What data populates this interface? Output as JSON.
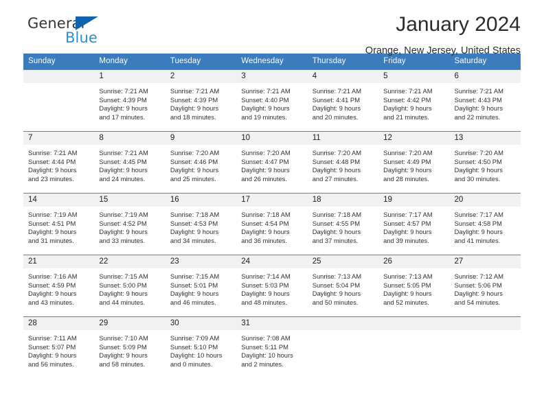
{
  "brand": {
    "name_part1": "General",
    "name_part2": "Blue",
    "triangle_icon": "triangle-flag-icon",
    "accent_color": "#2a8fd4",
    "triangle_color": "#1263ae"
  },
  "header": {
    "title": "January 2024",
    "subtitle": "Orange, New Jersey, United States"
  },
  "theme": {
    "header_row_bg": "#3a7cbe",
    "header_row_text": "#ffffff",
    "daynum_bg": "#f1f1f1",
    "row_border": "#4a86bf"
  },
  "calendar": {
    "weekday_headers": [
      "Sunday",
      "Monday",
      "Tuesday",
      "Wednesday",
      "Thursday",
      "Friday",
      "Saturday"
    ],
    "weeks": [
      [
        {
          "day": "",
          "empty": true,
          "sunrise": "",
          "sunset": "",
          "daylight_line1": "",
          "daylight_line2": ""
        },
        {
          "day": "1",
          "sunrise": "Sunrise: 7:21 AM",
          "sunset": "Sunset: 4:39 PM",
          "daylight_line1": "Daylight: 9 hours",
          "daylight_line2": "and 17 minutes."
        },
        {
          "day": "2",
          "sunrise": "Sunrise: 7:21 AM",
          "sunset": "Sunset: 4:39 PM",
          "daylight_line1": "Daylight: 9 hours",
          "daylight_line2": "and 18 minutes."
        },
        {
          "day": "3",
          "sunrise": "Sunrise: 7:21 AM",
          "sunset": "Sunset: 4:40 PM",
          "daylight_line1": "Daylight: 9 hours",
          "daylight_line2": "and 19 minutes."
        },
        {
          "day": "4",
          "sunrise": "Sunrise: 7:21 AM",
          "sunset": "Sunset: 4:41 PM",
          "daylight_line1": "Daylight: 9 hours",
          "daylight_line2": "and 20 minutes."
        },
        {
          "day": "5",
          "sunrise": "Sunrise: 7:21 AM",
          "sunset": "Sunset: 4:42 PM",
          "daylight_line1": "Daylight: 9 hours",
          "daylight_line2": "and 21 minutes."
        },
        {
          "day": "6",
          "sunrise": "Sunrise: 7:21 AM",
          "sunset": "Sunset: 4:43 PM",
          "daylight_line1": "Daylight: 9 hours",
          "daylight_line2": "and 22 minutes."
        }
      ],
      [
        {
          "day": "7",
          "sunrise": "Sunrise: 7:21 AM",
          "sunset": "Sunset: 4:44 PM",
          "daylight_line1": "Daylight: 9 hours",
          "daylight_line2": "and 23 minutes."
        },
        {
          "day": "8",
          "sunrise": "Sunrise: 7:21 AM",
          "sunset": "Sunset: 4:45 PM",
          "daylight_line1": "Daylight: 9 hours",
          "daylight_line2": "and 24 minutes."
        },
        {
          "day": "9",
          "sunrise": "Sunrise: 7:20 AM",
          "sunset": "Sunset: 4:46 PM",
          "daylight_line1": "Daylight: 9 hours",
          "daylight_line2": "and 25 minutes."
        },
        {
          "day": "10",
          "sunrise": "Sunrise: 7:20 AM",
          "sunset": "Sunset: 4:47 PM",
          "daylight_line1": "Daylight: 9 hours",
          "daylight_line2": "and 26 minutes."
        },
        {
          "day": "11",
          "sunrise": "Sunrise: 7:20 AM",
          "sunset": "Sunset: 4:48 PM",
          "daylight_line1": "Daylight: 9 hours",
          "daylight_line2": "and 27 minutes."
        },
        {
          "day": "12",
          "sunrise": "Sunrise: 7:20 AM",
          "sunset": "Sunset: 4:49 PM",
          "daylight_line1": "Daylight: 9 hours",
          "daylight_line2": "and 28 minutes."
        },
        {
          "day": "13",
          "sunrise": "Sunrise: 7:20 AM",
          "sunset": "Sunset: 4:50 PM",
          "daylight_line1": "Daylight: 9 hours",
          "daylight_line2": "and 30 minutes."
        }
      ],
      [
        {
          "day": "14",
          "sunrise": "Sunrise: 7:19 AM",
          "sunset": "Sunset: 4:51 PM",
          "daylight_line1": "Daylight: 9 hours",
          "daylight_line2": "and 31 minutes."
        },
        {
          "day": "15",
          "sunrise": "Sunrise: 7:19 AM",
          "sunset": "Sunset: 4:52 PM",
          "daylight_line1": "Daylight: 9 hours",
          "daylight_line2": "and 33 minutes."
        },
        {
          "day": "16",
          "sunrise": "Sunrise: 7:18 AM",
          "sunset": "Sunset: 4:53 PM",
          "daylight_line1": "Daylight: 9 hours",
          "daylight_line2": "and 34 minutes."
        },
        {
          "day": "17",
          "sunrise": "Sunrise: 7:18 AM",
          "sunset": "Sunset: 4:54 PM",
          "daylight_line1": "Daylight: 9 hours",
          "daylight_line2": "and 36 minutes."
        },
        {
          "day": "18",
          "sunrise": "Sunrise: 7:18 AM",
          "sunset": "Sunset: 4:55 PM",
          "daylight_line1": "Daylight: 9 hours",
          "daylight_line2": "and 37 minutes."
        },
        {
          "day": "19",
          "sunrise": "Sunrise: 7:17 AM",
          "sunset": "Sunset: 4:57 PM",
          "daylight_line1": "Daylight: 9 hours",
          "daylight_line2": "and 39 minutes."
        },
        {
          "day": "20",
          "sunrise": "Sunrise: 7:17 AM",
          "sunset": "Sunset: 4:58 PM",
          "daylight_line1": "Daylight: 9 hours",
          "daylight_line2": "and 41 minutes."
        }
      ],
      [
        {
          "day": "21",
          "sunrise": "Sunrise: 7:16 AM",
          "sunset": "Sunset: 4:59 PM",
          "daylight_line1": "Daylight: 9 hours",
          "daylight_line2": "and 43 minutes."
        },
        {
          "day": "22",
          "sunrise": "Sunrise: 7:15 AM",
          "sunset": "Sunset: 5:00 PM",
          "daylight_line1": "Daylight: 9 hours",
          "daylight_line2": "and 44 minutes."
        },
        {
          "day": "23",
          "sunrise": "Sunrise: 7:15 AM",
          "sunset": "Sunset: 5:01 PM",
          "daylight_line1": "Daylight: 9 hours",
          "daylight_line2": "and 46 minutes."
        },
        {
          "day": "24",
          "sunrise": "Sunrise: 7:14 AM",
          "sunset": "Sunset: 5:03 PM",
          "daylight_line1": "Daylight: 9 hours",
          "daylight_line2": "and 48 minutes."
        },
        {
          "day": "25",
          "sunrise": "Sunrise: 7:13 AM",
          "sunset": "Sunset: 5:04 PM",
          "daylight_line1": "Daylight: 9 hours",
          "daylight_line2": "and 50 minutes."
        },
        {
          "day": "26",
          "sunrise": "Sunrise: 7:13 AM",
          "sunset": "Sunset: 5:05 PM",
          "daylight_line1": "Daylight: 9 hours",
          "daylight_line2": "and 52 minutes."
        },
        {
          "day": "27",
          "sunrise": "Sunrise: 7:12 AM",
          "sunset": "Sunset: 5:06 PM",
          "daylight_line1": "Daylight: 9 hours",
          "daylight_line2": "and 54 minutes."
        }
      ],
      [
        {
          "day": "28",
          "sunrise": "Sunrise: 7:11 AM",
          "sunset": "Sunset: 5:07 PM",
          "daylight_line1": "Daylight: 9 hours",
          "daylight_line2": "and 56 minutes."
        },
        {
          "day": "29",
          "sunrise": "Sunrise: 7:10 AM",
          "sunset": "Sunset: 5:09 PM",
          "daylight_line1": "Daylight: 9 hours",
          "daylight_line2": "and 58 minutes."
        },
        {
          "day": "30",
          "sunrise": "Sunrise: 7:09 AM",
          "sunset": "Sunset: 5:10 PM",
          "daylight_line1": "Daylight: 10 hours",
          "daylight_line2": "and 0 minutes."
        },
        {
          "day": "31",
          "sunrise": "Sunrise: 7:08 AM",
          "sunset": "Sunset: 5:11 PM",
          "daylight_line1": "Daylight: 10 hours",
          "daylight_line2": "and 2 minutes."
        },
        {
          "day": "",
          "empty": true,
          "sunrise": "",
          "sunset": "",
          "daylight_line1": "",
          "daylight_line2": ""
        },
        {
          "day": "",
          "empty": true,
          "sunrise": "",
          "sunset": "",
          "daylight_line1": "",
          "daylight_line2": ""
        },
        {
          "day": "",
          "empty": true,
          "sunrise": "",
          "sunset": "",
          "daylight_line1": "",
          "daylight_line2": ""
        }
      ]
    ]
  }
}
